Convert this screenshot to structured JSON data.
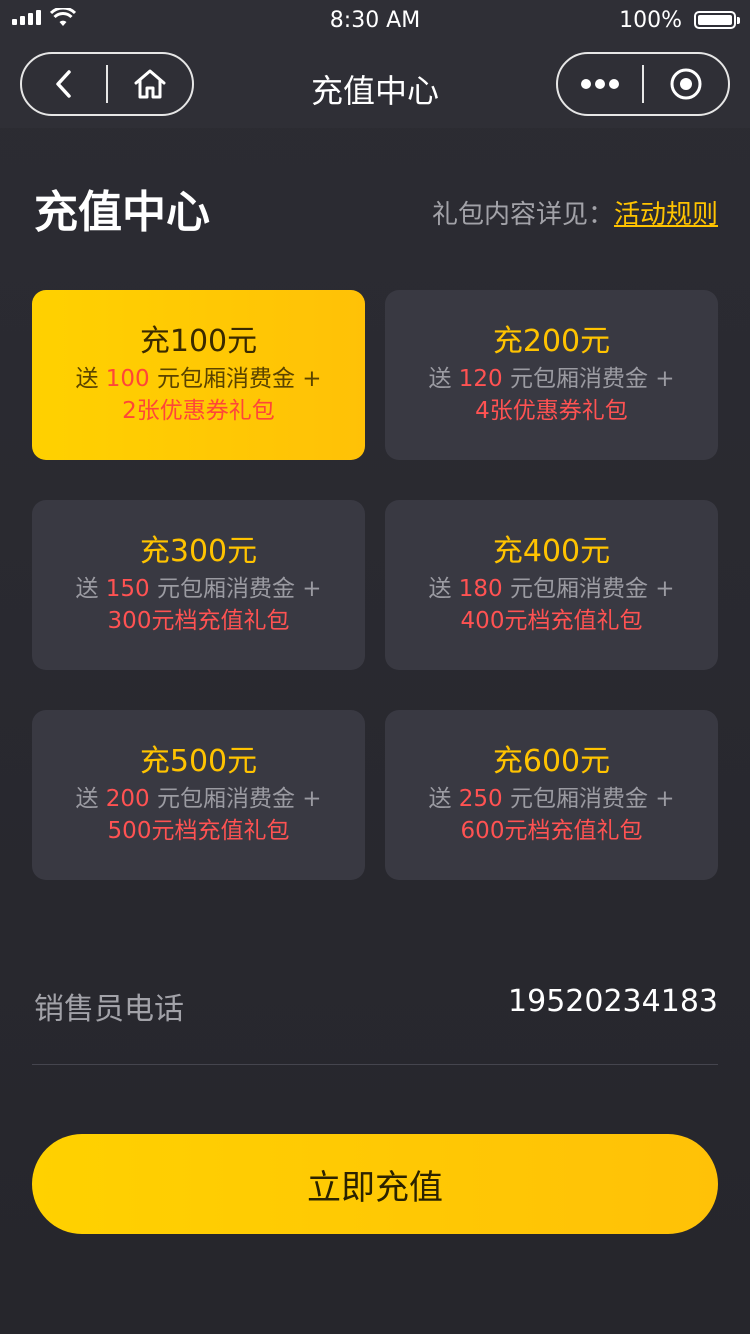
{
  "status_bar": {
    "time": "8:30 AM",
    "battery": "100%"
  },
  "nav": {
    "title": "充值中心"
  },
  "header": {
    "title": "充值中心",
    "rules_prefix": "礼包内容详见：",
    "rules_link": "活动规则"
  },
  "packages": [
    {
      "amount": "充100元",
      "gift_prefix": "送 ",
      "gift_value": "100",
      "gift_suffix": " 元包厢消费金 +",
      "bonus": "2张优惠券礼包",
      "selected": true
    },
    {
      "amount": "充200元",
      "gift_prefix": "送 ",
      "gift_value": "120",
      "gift_suffix": " 元包厢消费金 +",
      "bonus": "4张优惠券礼包",
      "selected": false
    },
    {
      "amount": "充300元",
      "gift_prefix": "送 ",
      "gift_value": "150",
      "gift_suffix": " 元包厢消费金 +",
      "bonus": "300元档充值礼包",
      "selected": false
    },
    {
      "amount": "充400元",
      "gift_prefix": "送 ",
      "gift_value": "180",
      "gift_suffix": " 元包厢消费金 +",
      "bonus": "400元档充值礼包",
      "selected": false
    },
    {
      "amount": "充500元",
      "gift_prefix": "送 ",
      "gift_value": "200",
      "gift_suffix": " 元包厢消费金 +",
      "bonus": "500元档充值礼包",
      "selected": false
    },
    {
      "amount": "充600元",
      "gift_prefix": "送 ",
      "gift_value": "250",
      "gift_suffix": " 元包厢消费金 +",
      "bonus": "600元档充值礼包",
      "selected": false
    }
  ],
  "sales": {
    "label": "销售员电话",
    "phone": "19520234183"
  },
  "submit": {
    "label": "立即充值"
  },
  "colors": {
    "accent": "#ffc300",
    "highlight_red": "#ff5252",
    "card_bg": "#393942",
    "page_bg": "#2c2c33"
  },
  "icons": {
    "back": "chevron-left-icon",
    "home": "home-icon",
    "more": "more-dots-icon",
    "close": "target-circle-icon"
  }
}
